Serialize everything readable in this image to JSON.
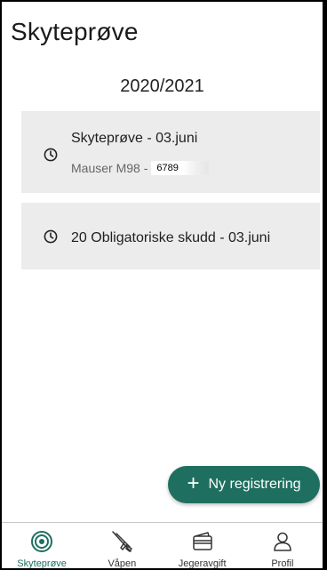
{
  "header": {
    "title": "Skyteprøve"
  },
  "season": "2020/2021",
  "cards": [
    {
      "title": "Skyteprøve - 03.juni",
      "subtitle": "Mauser M98 -",
      "serial": "6789",
      "icon": "clock-icon"
    },
    {
      "title": "20 Obligatoriske skudd - 03.juni",
      "icon": "clock-icon"
    }
  ],
  "fab": {
    "label": "Ny registrering",
    "icon": "plus-icon"
  },
  "bottom_nav": [
    {
      "label": "Skyteprøve",
      "icon": "target-icon",
      "active": true
    },
    {
      "label": "Våpen",
      "icon": "rifle-icon",
      "active": false
    },
    {
      "label": "Jegeravgift",
      "icon": "wallet-icon",
      "active": false
    },
    {
      "label": "Profil",
      "icon": "person-icon",
      "active": false
    }
  ],
  "colors": {
    "accent": "#1f6f60",
    "card_bg": "#ececec"
  }
}
